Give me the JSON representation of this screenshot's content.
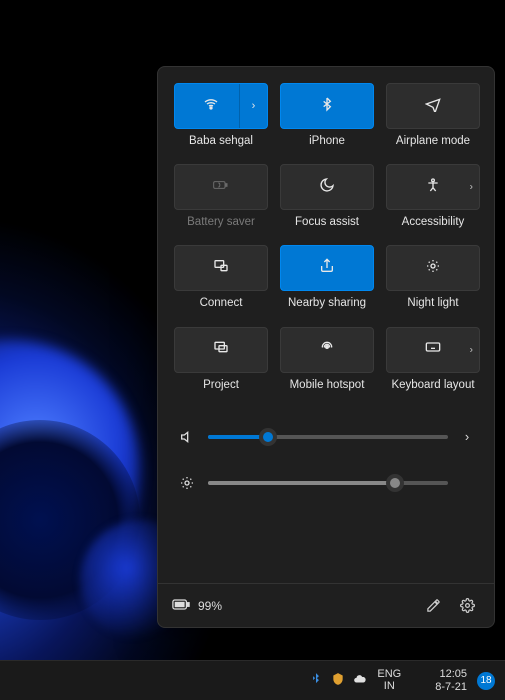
{
  "quick_settings": {
    "tiles": [
      {
        "id": "wifi",
        "label": "Baba sehgal",
        "active": true,
        "disabled": false,
        "split": true,
        "chevron": false
      },
      {
        "id": "bluetooth",
        "label": "iPhone",
        "active": true,
        "disabled": false,
        "split": false,
        "chevron": false
      },
      {
        "id": "airplane-mode",
        "label": "Airplane mode",
        "active": false,
        "disabled": false,
        "split": false,
        "chevron": false
      },
      {
        "id": "battery-saver",
        "label": "Battery saver",
        "active": false,
        "disabled": true,
        "split": false,
        "chevron": false
      },
      {
        "id": "focus-assist",
        "label": "Focus assist",
        "active": false,
        "disabled": false,
        "split": false,
        "chevron": false
      },
      {
        "id": "accessibility",
        "label": "Accessibility",
        "active": false,
        "disabled": false,
        "split": false,
        "chevron": true
      },
      {
        "id": "connect",
        "label": "Connect",
        "active": false,
        "disabled": false,
        "split": false,
        "chevron": false
      },
      {
        "id": "nearby-sharing",
        "label": "Nearby sharing",
        "active": true,
        "disabled": false,
        "split": false,
        "chevron": false
      },
      {
        "id": "night-light",
        "label": "Night light",
        "active": false,
        "disabled": false,
        "split": false,
        "chevron": false
      },
      {
        "id": "project",
        "label": "Project",
        "active": false,
        "disabled": false,
        "split": false,
        "chevron": false
      },
      {
        "id": "mobile-hotspot",
        "label": "Mobile hotspot",
        "active": false,
        "disabled": false,
        "split": false,
        "chevron": false
      },
      {
        "id": "keyboard-layout",
        "label": "Keyboard layout",
        "active": false,
        "disabled": false,
        "split": false,
        "chevron": true
      }
    ],
    "volume_percent": 25,
    "brightness_percent": 78,
    "battery_text": "99%"
  },
  "taskbar": {
    "language_line1": "ENG",
    "language_line2": "IN",
    "time": "12:05",
    "date": "8-7-21",
    "notification_count": "18"
  }
}
